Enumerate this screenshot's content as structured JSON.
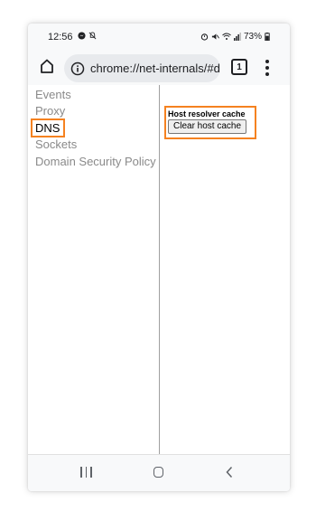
{
  "status_bar": {
    "time": "12:56",
    "battery": "73%"
  },
  "toolbar": {
    "url": "chrome://net-internals/#dns",
    "tab_count": "1"
  },
  "sidebar": {
    "items": [
      {
        "label": "Events"
      },
      {
        "label": "Proxy"
      },
      {
        "label": "DNS"
      },
      {
        "label": "Sockets"
      },
      {
        "label": "Domain Security Policy"
      }
    ],
    "active": "DNS"
  },
  "main": {
    "section_title": "Host resolver cache",
    "clear_button_label": "Clear host cache"
  },
  "colors": {
    "highlight": "#f58220",
    "active_text": "#000000",
    "inactive_text": "#8a8a8a"
  },
  "icons": [
    "home-icon",
    "info-icon",
    "tab-switcher-icon",
    "more-menu-icon",
    "recents-icon",
    "home-nav-icon",
    "back-icon",
    "alarm-icon",
    "mute-icon",
    "wifi-icon",
    "signal-icon",
    "battery-icon"
  ]
}
